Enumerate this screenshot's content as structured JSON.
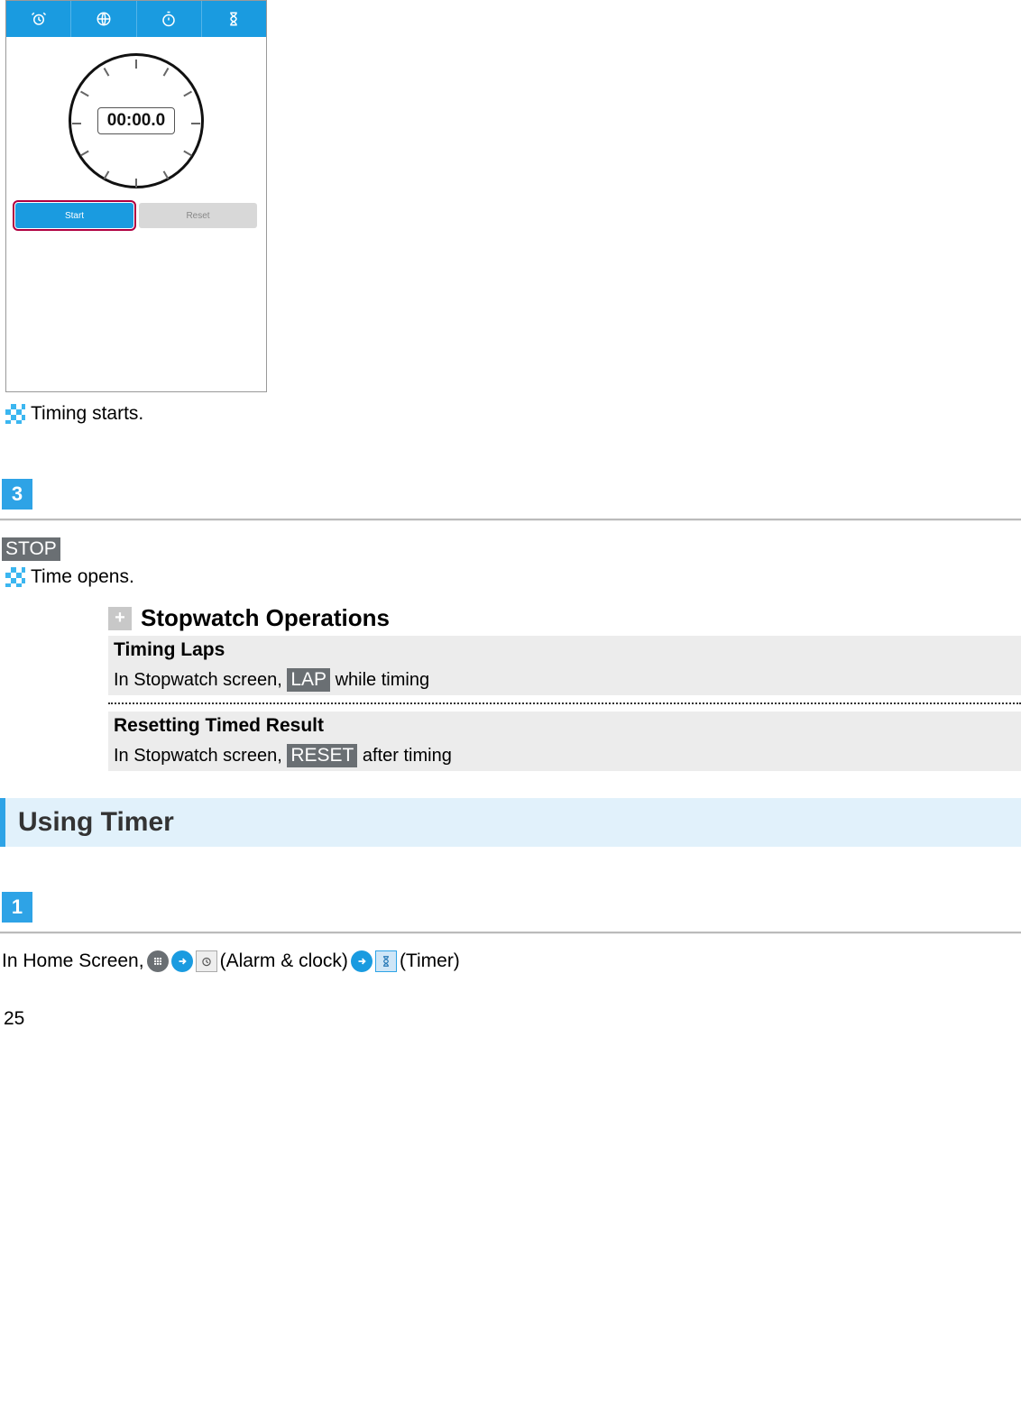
{
  "phone": {
    "clock_time": "00:00.0",
    "start_label": "Start",
    "reset_label": "Reset"
  },
  "result1": "Timing starts.",
  "step3": "3",
  "stop_label": "STOP",
  "result2": "Time opens.",
  "ops": {
    "title": "Stopwatch Operations",
    "laps_heading": "Timing Laps",
    "laps_desc_prefix": "In Stopwatch screen, ",
    "laps_button": "LAP",
    "laps_desc_suffix": " while timing",
    "reset_heading": "Resetting Timed Result",
    "reset_desc_prefix": "In Stopwatch screen, ",
    "reset_button": "RESET",
    "reset_desc_suffix": " after timing"
  },
  "section_timer": "Using Timer",
  "step1": "1",
  "flow": {
    "prefix": "In Home Screen, ",
    "alarm_clock": " (Alarm & clock)",
    "timer": " (Timer)"
  },
  "page_number": "25"
}
